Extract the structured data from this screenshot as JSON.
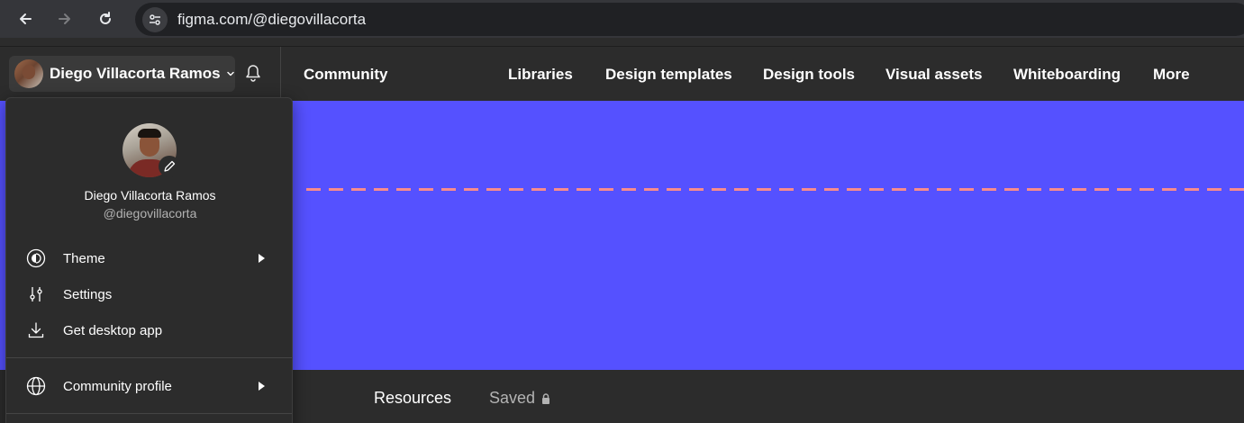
{
  "browser": {
    "url": "figma.com/@diegovillacorta"
  },
  "header": {
    "user_name": "Diego Villacorta Ramos",
    "community": "Community",
    "nav_links": [
      "Libraries",
      "Design templates",
      "Design tools",
      "Visual assets",
      "Whiteboarding",
      "More"
    ]
  },
  "banner": {
    "color": "#5551ff",
    "dash_color": "#f98c8c"
  },
  "bottom_tabs": {
    "resources": "Resources",
    "saved": "Saved"
  },
  "dropdown": {
    "name": "Diego Villacorta Ramos",
    "handle": "@diegovillacorta",
    "items": [
      {
        "label": "Theme",
        "icon": "theme-icon",
        "has_submenu": true
      },
      {
        "label": "Settings",
        "icon": "settings-sliders-icon",
        "has_submenu": false
      },
      {
        "label": "Get desktop app",
        "icon": "download-icon",
        "has_submenu": false
      },
      {
        "label": "Community profile",
        "icon": "globe-icon",
        "has_submenu": true
      }
    ]
  }
}
